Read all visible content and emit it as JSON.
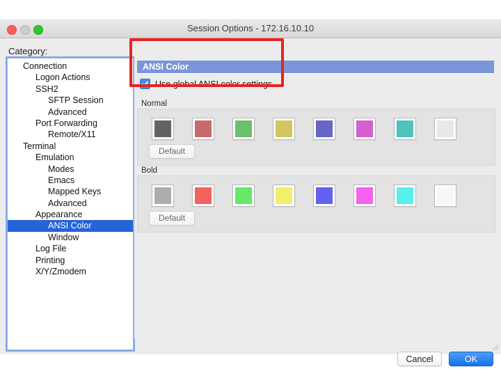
{
  "window": {
    "title": "Session Options - 172.16.10.10",
    "traffic_lights": [
      "close-red",
      "minimize-gray",
      "maximize-green"
    ]
  },
  "sidebar": {
    "label": "Category:",
    "items": [
      {
        "label": "Connection",
        "level": 0,
        "disclosure": "▼",
        "selected": false
      },
      {
        "label": "Logon Actions",
        "level": 1,
        "disclosure": "",
        "selected": false
      },
      {
        "label": "SSH2",
        "level": 1,
        "disclosure": "▼",
        "selected": false
      },
      {
        "label": "SFTP Session",
        "level": 2,
        "disclosure": "",
        "selected": false
      },
      {
        "label": "Advanced",
        "level": 2,
        "disclosure": "",
        "selected": false
      },
      {
        "label": "Port Forwarding",
        "level": 1,
        "disclosure": "▼",
        "selected": false
      },
      {
        "label": "Remote/X11",
        "level": 2,
        "disclosure": "",
        "selected": false
      },
      {
        "label": "Terminal",
        "level": 0,
        "disclosure": "▼",
        "selected": false
      },
      {
        "label": "Emulation",
        "level": 1,
        "disclosure": "▼",
        "selected": false
      },
      {
        "label": "Modes",
        "level": 2,
        "disclosure": "",
        "selected": false
      },
      {
        "label": "Emacs",
        "level": 2,
        "disclosure": "",
        "selected": false
      },
      {
        "label": "Mapped Keys",
        "level": 2,
        "disclosure": "",
        "selected": false
      },
      {
        "label": "Advanced",
        "level": 2,
        "disclosure": "",
        "selected": false
      },
      {
        "label": "Appearance",
        "level": 1,
        "disclosure": "▼",
        "selected": false
      },
      {
        "label": "ANSI Color",
        "level": 2,
        "disclosure": "",
        "selected": true
      },
      {
        "label": "Window",
        "level": 2,
        "disclosure": "",
        "selected": false
      },
      {
        "label": "Log File",
        "level": 1,
        "disclosure": "",
        "selected": false
      },
      {
        "label": "Printing",
        "level": 1,
        "disclosure": "",
        "selected": false
      },
      {
        "label": "X/Y/Zmodem",
        "level": 1,
        "disclosure": "",
        "selected": false
      }
    ]
  },
  "main": {
    "section_title": "ANSI Color",
    "section_header_color": "#7a95d8",
    "use_global_checkbox": {
      "label": "Use global ANSI color settings",
      "checked": true,
      "accent": "#3b8ef3"
    },
    "normal": {
      "label": "Normal",
      "default_button": "Default",
      "colors": [
        "#636363",
        "#c96a6a",
        "#6cbf6c",
        "#cfc860",
        "#6665c8",
        "#d45fd0",
        "#4fc4bd",
        "#e8e8e8"
      ]
    },
    "bold": {
      "label": "Bold",
      "default_button": "Default",
      "colors": [
        "#adadad",
        "#f2625f",
        "#67e867",
        "#f3ef6a",
        "#6262ef",
        "#f562f0",
        "#57f0ef",
        "#f7f7f7"
      ]
    }
  },
  "footer": {
    "cancel_label": "Cancel",
    "ok_label": "OK",
    "ok_color": "#1474ec"
  },
  "annotation": {
    "color": "#e8231f",
    "target": "Use global ANSI color settings"
  }
}
